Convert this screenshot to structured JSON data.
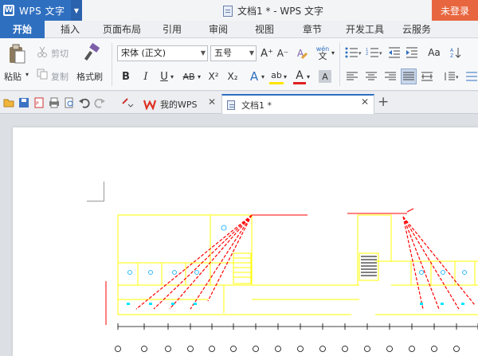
{
  "app": {
    "name": "WPS 文字",
    "logo_letter": "W",
    "title": "文档1 * - WPS 文字",
    "login": "未登录"
  },
  "menus": [
    {
      "label": "开始",
      "active": true
    },
    {
      "label": "插入"
    },
    {
      "label": "页面布局"
    },
    {
      "label": "引用"
    },
    {
      "label": "审阅"
    },
    {
      "label": "视图"
    },
    {
      "label": "章节"
    },
    {
      "label": "开发工具"
    },
    {
      "label": "云服务"
    }
  ],
  "ribbon": {
    "paste": "粘贴",
    "cut": "剪切",
    "copy": "复制",
    "format_painter": "格式刷",
    "font_name": "宋体 (正文)",
    "font_size": "五号",
    "bold": "B",
    "italic": "I",
    "underline": "U",
    "strike": "AB",
    "superscript": "X²",
    "subscript": "X₂",
    "grow_font": "A⁺",
    "shrink_font": "A⁻",
    "phonetic": "wén",
    "font_color": "A",
    "highlight": "ab",
    "text_effect": "A",
    "char_shading": "A",
    "case": "Aa"
  },
  "tabs": [
    {
      "label": "我的WPS"
    },
    {
      "label": "文档1 *"
    }
  ],
  "colors": {
    "accent": "#2f6fc0",
    "login": "#e8663f",
    "plan_line": "#ffff00",
    "plan_red": "#ff0000"
  }
}
